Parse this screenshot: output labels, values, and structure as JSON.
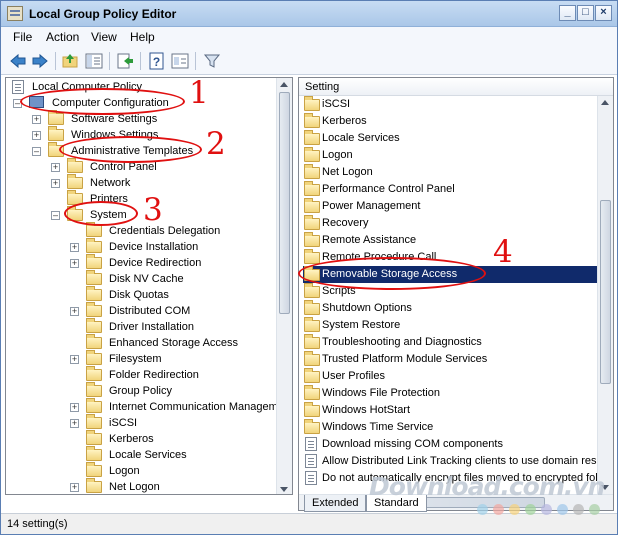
{
  "window": {
    "title": "Local Group Policy Editor"
  },
  "menubar": [
    {
      "label": "File"
    },
    {
      "label": "Action"
    },
    {
      "label": "View"
    },
    {
      "label": "Help"
    }
  ],
  "tree": [
    {
      "label": "Local Computer Policy",
      "icon": "document-icon"
    },
    {
      "label": "Computer Configuration",
      "icon": "computer-icon",
      "expander": "-"
    },
    {
      "label": "Software Settings",
      "icon": "folder-icon",
      "expander": "+"
    },
    {
      "label": "Windows Settings",
      "icon": "folder-icon",
      "expander": "+"
    },
    {
      "label": "Administrative Templates",
      "icon": "folder-icon",
      "expander": "-"
    },
    {
      "label": "Control Panel",
      "icon": "folder-icon",
      "expander": "+"
    },
    {
      "label": "Network",
      "icon": "folder-icon",
      "expander": "+"
    },
    {
      "label": "Printers",
      "icon": "folder-icon",
      "expander": ""
    },
    {
      "label": "System",
      "icon": "folder-icon",
      "expander": "-"
    },
    {
      "label": "Credentials Delegation",
      "icon": "folder-icon",
      "expander": ""
    },
    {
      "label": "Device Installation",
      "icon": "folder-icon",
      "expander": "+"
    },
    {
      "label": "Device Redirection",
      "icon": "folder-icon",
      "expander": "+"
    },
    {
      "label": "Disk NV Cache",
      "icon": "folder-icon",
      "expander": ""
    },
    {
      "label": "Disk Quotas",
      "icon": "folder-icon",
      "expander": ""
    },
    {
      "label": "Distributed COM",
      "icon": "folder-icon",
      "expander": "+"
    },
    {
      "label": "Driver Installation",
      "icon": "folder-icon",
      "expander": ""
    },
    {
      "label": "Enhanced Storage Access",
      "icon": "folder-icon",
      "expander": ""
    },
    {
      "label": "Filesystem",
      "icon": "folder-icon",
      "expander": "+"
    },
    {
      "label": "Folder Redirection",
      "icon": "folder-icon",
      "expander": ""
    },
    {
      "label": "Group Policy",
      "icon": "folder-icon",
      "expander": ""
    },
    {
      "label": "Internet Communication Manageme",
      "icon": "folder-icon",
      "expander": "+"
    },
    {
      "label": "iSCSI",
      "icon": "folder-icon",
      "expander": "+"
    },
    {
      "label": "Kerberos",
      "icon": "folder-icon",
      "expander": ""
    },
    {
      "label": "Locale Services",
      "icon": "folder-icon",
      "expander": ""
    },
    {
      "label": "Logon",
      "icon": "folder-icon",
      "expander": ""
    },
    {
      "label": "Net Logon",
      "icon": "folder-icon",
      "expander": "+"
    }
  ],
  "list": {
    "column_header": "Setting",
    "items": [
      {
        "label": "iSCSI",
        "icon": "folder-icon"
      },
      {
        "label": "Kerberos",
        "icon": "folder-icon"
      },
      {
        "label": "Locale Services",
        "icon": "folder-icon"
      },
      {
        "label": "Logon",
        "icon": "folder-icon"
      },
      {
        "label": "Net Logon",
        "icon": "folder-icon"
      },
      {
        "label": "Performance Control Panel",
        "icon": "folder-icon"
      },
      {
        "label": "Power Management",
        "icon": "folder-icon"
      },
      {
        "label": "Recovery",
        "icon": "folder-icon"
      },
      {
        "label": "Remote Assistance",
        "icon": "folder-icon"
      },
      {
        "label": "Remote Procedure Call",
        "icon": "folder-icon"
      },
      {
        "label": "Removable Storage Access",
        "icon": "folder-icon",
        "selected": true
      },
      {
        "label": "Scripts",
        "icon": "folder-icon"
      },
      {
        "label": "Shutdown Options",
        "icon": "folder-icon"
      },
      {
        "label": "System Restore",
        "icon": "folder-icon"
      },
      {
        "label": "Troubleshooting and Diagnostics",
        "icon": "folder-icon"
      },
      {
        "label": "Trusted Platform Module Services",
        "icon": "folder-icon"
      },
      {
        "label": "User Profiles",
        "icon": "folder-icon"
      },
      {
        "label": "Windows File Protection",
        "icon": "folder-icon"
      },
      {
        "label": "Windows HotStart",
        "icon": "folder-icon"
      },
      {
        "label": "Windows Time Service",
        "icon": "folder-icon"
      },
      {
        "label": "Download missing COM components",
        "icon": "policy-icon"
      },
      {
        "label": "Allow Distributed Link Tracking clients to use domain resou",
        "icon": "policy-icon"
      },
      {
        "label": "Do not automatically encrypt files moved to encrypted fol",
        "icon": "policy-icon"
      }
    ]
  },
  "tabs": [
    {
      "label": "Extended"
    },
    {
      "label": "Standard"
    }
  ],
  "status": {
    "text": "14 setting(s)"
  },
  "annotations": [
    "1",
    "2",
    "3",
    "4"
  ],
  "watermark": {
    "text": "Download.com.vn"
  },
  "colors": {
    "selection": "#102a6b",
    "annotation": "#e01010"
  }
}
